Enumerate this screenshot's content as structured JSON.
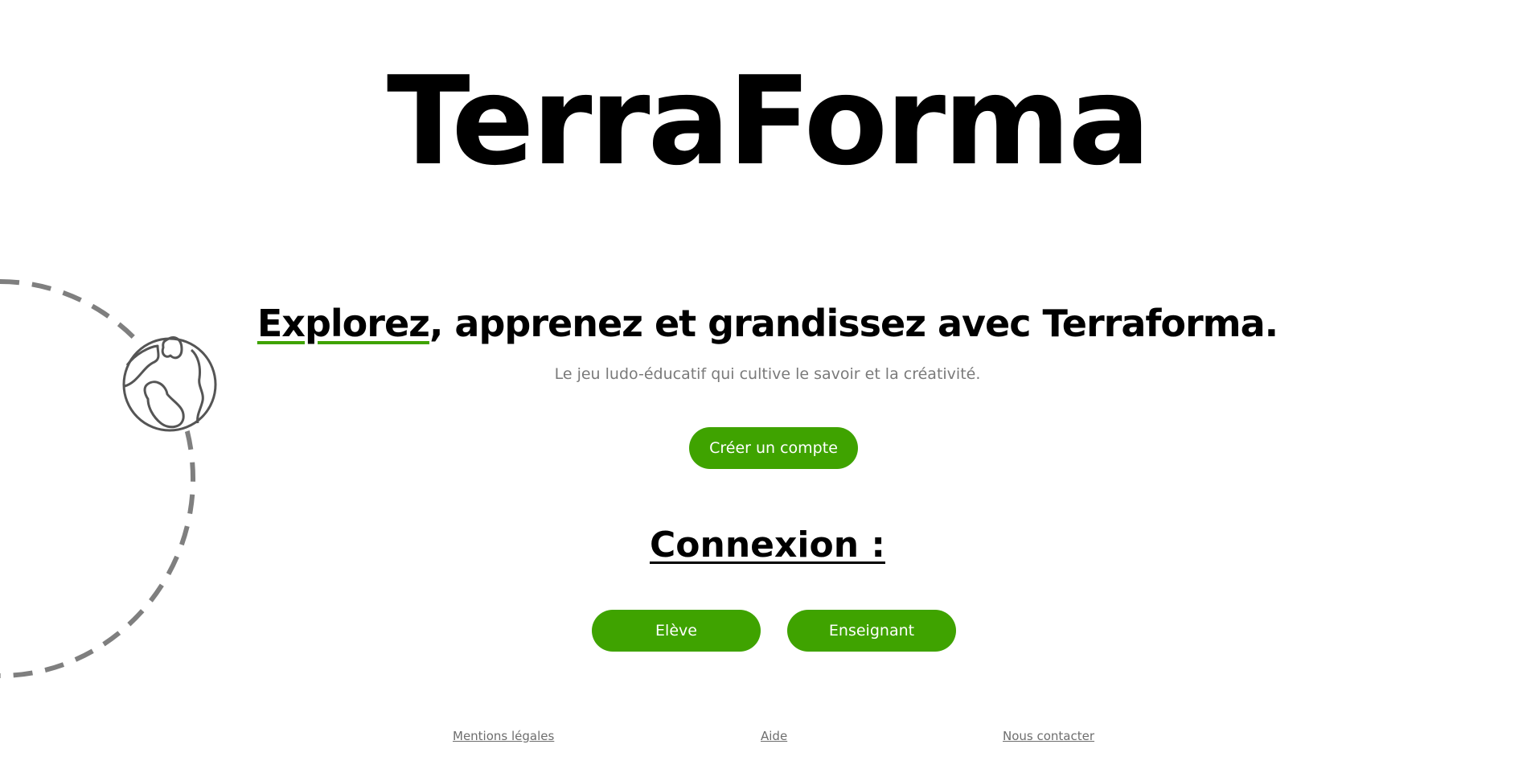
{
  "brand": {
    "logo_text": "TerraForma"
  },
  "hero": {
    "tagline_accent": "Explorez",
    "tagline_rest": ", apprenez et grandissez avec Terraforma.",
    "subtitle": "Le jeu ludo-éducatif qui cultive le savoir et la créativité.",
    "create_account_label": "Créer un compte"
  },
  "login": {
    "heading": "Connexion :",
    "student_label": "Elève",
    "teacher_label": "Enseignant"
  },
  "footer": {
    "links": [
      {
        "label": "Mentions légales"
      },
      {
        "label": "Aide"
      },
      {
        "label": "Nous contacter"
      }
    ]
  },
  "icons": {
    "globe": "globe-icon",
    "orbit": "orbit-decoration"
  },
  "colors": {
    "accent": "#3fa300",
    "text": "#000000",
    "muted": "#7a7a7a",
    "orbit": "#7f7f7f"
  }
}
